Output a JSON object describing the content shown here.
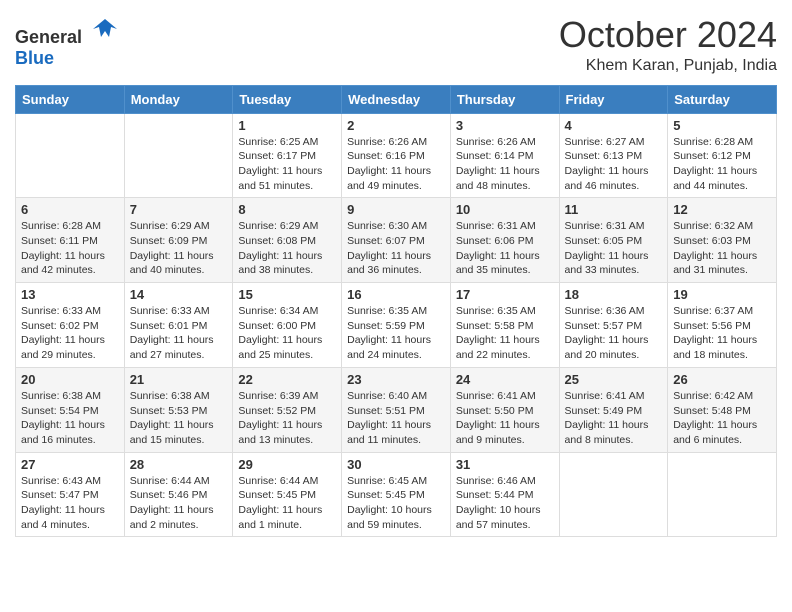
{
  "header": {
    "logo_general": "General",
    "logo_blue": "Blue",
    "month_title": "October 2024",
    "location": "Khem Karan, Punjab, India"
  },
  "calendar": {
    "headers": [
      "Sunday",
      "Monday",
      "Tuesday",
      "Wednesday",
      "Thursday",
      "Friday",
      "Saturday"
    ],
    "weeks": [
      [
        {
          "day": "",
          "content": ""
        },
        {
          "day": "",
          "content": ""
        },
        {
          "day": "1",
          "content": "Sunrise: 6:25 AM\nSunset: 6:17 PM\nDaylight: 11 hours and 51 minutes."
        },
        {
          "day": "2",
          "content": "Sunrise: 6:26 AM\nSunset: 6:16 PM\nDaylight: 11 hours and 49 minutes."
        },
        {
          "day": "3",
          "content": "Sunrise: 6:26 AM\nSunset: 6:14 PM\nDaylight: 11 hours and 48 minutes."
        },
        {
          "day": "4",
          "content": "Sunrise: 6:27 AM\nSunset: 6:13 PM\nDaylight: 11 hours and 46 minutes."
        },
        {
          "day": "5",
          "content": "Sunrise: 6:28 AM\nSunset: 6:12 PM\nDaylight: 11 hours and 44 minutes."
        }
      ],
      [
        {
          "day": "6",
          "content": "Sunrise: 6:28 AM\nSunset: 6:11 PM\nDaylight: 11 hours and 42 minutes."
        },
        {
          "day": "7",
          "content": "Sunrise: 6:29 AM\nSunset: 6:09 PM\nDaylight: 11 hours and 40 minutes."
        },
        {
          "day": "8",
          "content": "Sunrise: 6:29 AM\nSunset: 6:08 PM\nDaylight: 11 hours and 38 minutes."
        },
        {
          "day": "9",
          "content": "Sunrise: 6:30 AM\nSunset: 6:07 PM\nDaylight: 11 hours and 36 minutes."
        },
        {
          "day": "10",
          "content": "Sunrise: 6:31 AM\nSunset: 6:06 PM\nDaylight: 11 hours and 35 minutes."
        },
        {
          "day": "11",
          "content": "Sunrise: 6:31 AM\nSunset: 6:05 PM\nDaylight: 11 hours and 33 minutes."
        },
        {
          "day": "12",
          "content": "Sunrise: 6:32 AM\nSunset: 6:03 PM\nDaylight: 11 hours and 31 minutes."
        }
      ],
      [
        {
          "day": "13",
          "content": "Sunrise: 6:33 AM\nSunset: 6:02 PM\nDaylight: 11 hours and 29 minutes."
        },
        {
          "day": "14",
          "content": "Sunrise: 6:33 AM\nSunset: 6:01 PM\nDaylight: 11 hours and 27 minutes."
        },
        {
          "day": "15",
          "content": "Sunrise: 6:34 AM\nSunset: 6:00 PM\nDaylight: 11 hours and 25 minutes."
        },
        {
          "day": "16",
          "content": "Sunrise: 6:35 AM\nSunset: 5:59 PM\nDaylight: 11 hours and 24 minutes."
        },
        {
          "day": "17",
          "content": "Sunrise: 6:35 AM\nSunset: 5:58 PM\nDaylight: 11 hours and 22 minutes."
        },
        {
          "day": "18",
          "content": "Sunrise: 6:36 AM\nSunset: 5:57 PM\nDaylight: 11 hours and 20 minutes."
        },
        {
          "day": "19",
          "content": "Sunrise: 6:37 AM\nSunset: 5:56 PM\nDaylight: 11 hours and 18 minutes."
        }
      ],
      [
        {
          "day": "20",
          "content": "Sunrise: 6:38 AM\nSunset: 5:54 PM\nDaylight: 11 hours and 16 minutes."
        },
        {
          "day": "21",
          "content": "Sunrise: 6:38 AM\nSunset: 5:53 PM\nDaylight: 11 hours and 15 minutes."
        },
        {
          "day": "22",
          "content": "Sunrise: 6:39 AM\nSunset: 5:52 PM\nDaylight: 11 hours and 13 minutes."
        },
        {
          "day": "23",
          "content": "Sunrise: 6:40 AM\nSunset: 5:51 PM\nDaylight: 11 hours and 11 minutes."
        },
        {
          "day": "24",
          "content": "Sunrise: 6:41 AM\nSunset: 5:50 PM\nDaylight: 11 hours and 9 minutes."
        },
        {
          "day": "25",
          "content": "Sunrise: 6:41 AM\nSunset: 5:49 PM\nDaylight: 11 hours and 8 minutes."
        },
        {
          "day": "26",
          "content": "Sunrise: 6:42 AM\nSunset: 5:48 PM\nDaylight: 11 hours and 6 minutes."
        }
      ],
      [
        {
          "day": "27",
          "content": "Sunrise: 6:43 AM\nSunset: 5:47 PM\nDaylight: 11 hours and 4 minutes."
        },
        {
          "day": "28",
          "content": "Sunrise: 6:44 AM\nSunset: 5:46 PM\nDaylight: 11 hours and 2 minutes."
        },
        {
          "day": "29",
          "content": "Sunrise: 6:44 AM\nSunset: 5:45 PM\nDaylight: 11 hours and 1 minute."
        },
        {
          "day": "30",
          "content": "Sunrise: 6:45 AM\nSunset: 5:45 PM\nDaylight: 10 hours and 59 minutes."
        },
        {
          "day": "31",
          "content": "Sunrise: 6:46 AM\nSunset: 5:44 PM\nDaylight: 10 hours and 57 minutes."
        },
        {
          "day": "",
          "content": ""
        },
        {
          "day": "",
          "content": ""
        }
      ]
    ]
  }
}
